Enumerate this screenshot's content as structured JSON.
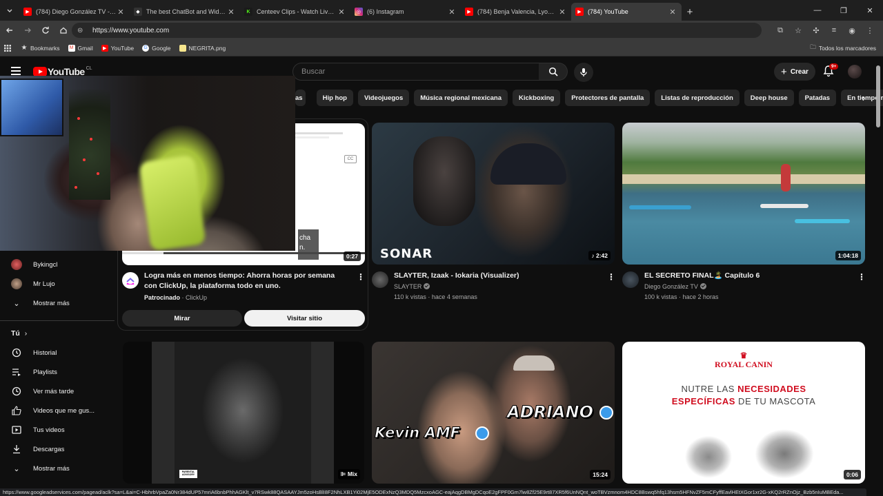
{
  "browser": {
    "tabs": [
      {
        "title": "(784) Diego González TV - YouT",
        "favicon_color": "#ff0000",
        "favicon_glyph": "▶"
      },
      {
        "title": "The best ChatBot and Widgets",
        "favicon_color": "#333333",
        "favicon_glyph": "◆"
      },
      {
        "title": "Centeev Clips - Watch Live on K",
        "favicon_color": "#53fc18",
        "favicon_glyph": "K"
      },
      {
        "title": "(6) Instagram",
        "favicon_color": "#d62976",
        "favicon_glyph": "◎"
      },
      {
        "title": "(784) Benja Valencia, Lyon La F",
        "favicon_color": "#ff0000",
        "favicon_glyph": "▶"
      },
      {
        "title": "(784) YouTube",
        "favicon_color": "#ff0000",
        "favicon_glyph": "▶"
      }
    ],
    "new_tab_label": "+",
    "url": "https://www.youtube.com",
    "bookmarks": [
      {
        "label": "Bookmarks",
        "icon": "star-icon"
      },
      {
        "label": "Gmail",
        "icon": "gmail-icon"
      },
      {
        "label": "YouTube",
        "icon": "youtube-icon"
      },
      {
        "label": "Google",
        "icon": "google-icon"
      },
      {
        "label": "NEGRITA.png",
        "icon": "image-icon"
      }
    ],
    "all_bookmarks_label": "Todos los marcadores",
    "status_url": "https://www.googleadservices.com/pagead/aclk?sa=L&ai=C-HbhrbVpaZa0Nr384dUP57mriA6bnbPhhAGKlt_v7RSwk88QASAAYJm5zoHsBlI8F2NhLXB1Yi02MjE5ODExNzQ3MDQ5MzcxoAGC-eajAqgDBMgDCqoE2gFPF0Gm7lw8Zf25E9rt87XR5f6UnNQnt_woTBVzmnom4HDC8Bswq5hfq13hsm5HFNvZF5mCFyffEavlHEtXGor1xr2G-xKQ2rRZnOjz_Bzb5nIuMBEda..."
  },
  "youtube": {
    "logo_text": "YouTube",
    "country": "CL",
    "search_placeholder": "Buscar",
    "create_label": "Crear",
    "notif_count": "9+",
    "chips": [
      "as",
      "Hip hop",
      "Videojuegos",
      "Música regional mexicana",
      "Kickboxing",
      "Protectores de pantalla",
      "Listas de reproducción",
      "Deep house",
      "Patadas",
      "En tiempo real"
    ]
  },
  "sidebar": {
    "subs": [
      {
        "label": "Bykingcl"
      },
      {
        "label": "Mr Lujo"
      },
      {
        "label": "Mostrar más"
      }
    ],
    "you_title": "Tú",
    "you_items": [
      {
        "label": "Historial",
        "icon": "history-icon"
      },
      {
        "label": "Playlists",
        "icon": "playlists-icon"
      },
      {
        "label": "Ver más tarde",
        "icon": "watch-later-icon"
      },
      {
        "label": "Videos que me gus...",
        "icon": "liked-icon"
      },
      {
        "label": "Tus videos",
        "icon": "your-videos-icon"
      },
      {
        "label": "Descargas",
        "icon": "downloads-icon"
      },
      {
        "label": "Mostrar más",
        "icon": "chevron-down-icon"
      }
    ]
  },
  "ad": {
    "title": "Logra más en menos tiempo: Ahorra horas por semana con ClickUp, la plataforma todo en uno.",
    "sponsored": "Patrocinado",
    "advertiser": "ClickUp",
    "duration": "0:27",
    "tooltip": "cha n.",
    "watch_label": "Mirar",
    "visit_label": "Visitar sitio",
    "cc_label": "CC"
  },
  "videos": [
    {
      "title": "SLAYTER, Izaak - Iokaria (Visualizer)",
      "channel": "SLAYTER",
      "meta": "110 k vistas · hace 4 semanas",
      "duration": "♪ 2:42",
      "overlay": "SONAR"
    },
    {
      "title": "EL SECRETO FINAL🏝️ Capítulo 6",
      "channel": "Diego González TV",
      "meta": "100 k vistas · hace 2 horas",
      "duration": "1:04:18"
    },
    {
      "title": "",
      "channel": "",
      "meta": "",
      "duration": "Mix",
      "overlay": "PARENTAL ADVISORY"
    },
    {
      "title": "",
      "channel": "",
      "meta": "",
      "duration": "15:24",
      "overlay": "ADRIANO",
      "overlay2": "Kevin AMF"
    },
    {
      "title": "",
      "channel": "",
      "meta": "",
      "duration": "0:06",
      "brand": "ROYAL CANIN",
      "line1": "NUTRE LAS ",
      "line1b": "NECESIDADES",
      "line2": "ESPECÍFICAS",
      "line2b": " DE TU MASCOTA"
    }
  ]
}
